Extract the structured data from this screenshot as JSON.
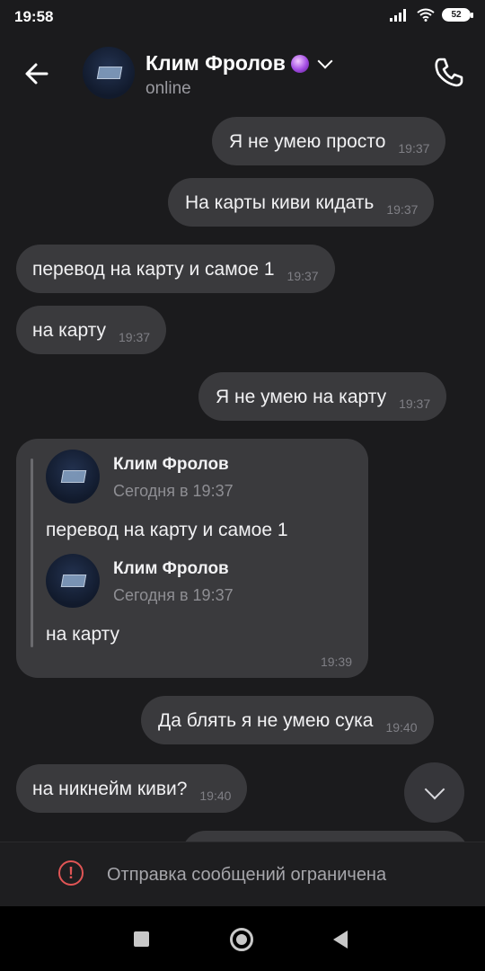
{
  "status_bar": {
    "time": "19:58",
    "battery": "52"
  },
  "header": {
    "contact_name": "Клим Фролов",
    "status": "online"
  },
  "messages": [
    {
      "direction": "out",
      "text": "Я не умею просто",
      "time": "19:37"
    },
    {
      "direction": "out",
      "text": "На карты киви кидать",
      "time": "19:37"
    },
    {
      "direction": "in",
      "text": "перевод на карту и самое 1",
      "time": "19:37"
    },
    {
      "direction": "in",
      "text": "на карту",
      "time": "19:37"
    },
    {
      "direction": "out",
      "text": "Я не умею на карту",
      "time": "19:37"
    },
    {
      "direction": "out",
      "text": "Да блять я не умею сука",
      "time": "19:40"
    },
    {
      "direction": "in",
      "text": "на никнейм киви?",
      "time": "19:40"
    }
  ],
  "forwarded": {
    "time": "19:39",
    "items": [
      {
        "author": "Клим Фролов",
        "date": "Сегодня в 19:37",
        "text": "перевод на карту и самое 1"
      },
      {
        "author": "Клим Фролов",
        "date": "Сегодня в 19:37",
        "text": "на карту"
      }
    ]
  },
  "restriction": {
    "text": "Отправка сообщений ограничена"
  },
  "icons": {
    "back": "arrow-left-icon",
    "call": "phone-icon",
    "scroll_down": "chevron-down-icon",
    "warning": "exclamation-circle-icon"
  },
  "colors": {
    "background": "#1b1b1d",
    "bubble": "#3a3a3d",
    "warning": "#e05555"
  }
}
